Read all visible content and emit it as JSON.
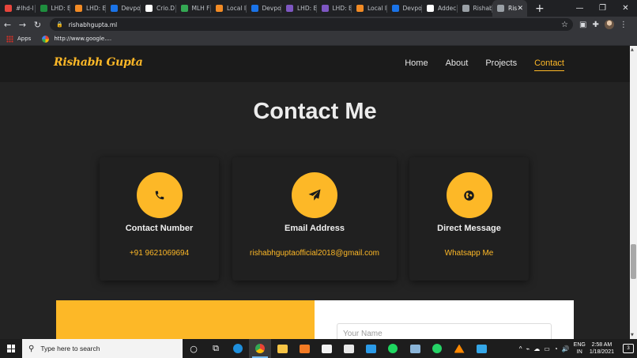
{
  "browser": {
    "tabs": [
      {
        "label": "#lhd-l",
        "color": "#e8453c"
      },
      {
        "label": "LHD: B",
        "color": "#1e8e3e"
      },
      {
        "label": "LHD: B",
        "color": "#f28b25"
      },
      {
        "label": "Devpo",
        "color": "#1a73e8"
      },
      {
        "label": "Crio.D",
        "color": "#ffffff"
      },
      {
        "label": "MLH F",
        "color": "#34a853"
      },
      {
        "label": "Local I",
        "color": "#f28b25"
      },
      {
        "label": "Devpo",
        "color": "#1a73e8"
      },
      {
        "label": "LHD: B",
        "color": "#7e57c2"
      },
      {
        "label": "LHD: B",
        "color": "#7e57c2"
      },
      {
        "label": "Local I",
        "color": "#f28b25"
      },
      {
        "label": "Devpo",
        "color": "#1a73e8"
      },
      {
        "label": "Addec",
        "color": "#ffffff"
      },
      {
        "label": "Rishab",
        "color": "#9aa0a6"
      },
      {
        "label": "Ris",
        "color": "#9aa0a6",
        "active": true
      }
    ],
    "new_tab": "+",
    "window_controls": {
      "minimize": "—",
      "maximize": "❐",
      "close": "✕"
    },
    "url": "rishabhgupta.ml",
    "bookmarks": [
      {
        "label": "Apps",
        "icon": "apps-grid-icon"
      },
      {
        "label": "http://www.google....",
        "icon": "google-icon"
      }
    ]
  },
  "site": {
    "logo": "Rishabh Gupta",
    "nav": [
      {
        "label": "Home",
        "active": false
      },
      {
        "label": "About",
        "active": false
      },
      {
        "label": "Projects",
        "active": false
      },
      {
        "label": "Contact",
        "active": true
      }
    ],
    "section_title": "Contact Me",
    "cards": [
      {
        "title": "Contact Number",
        "value": "+91 9621069694",
        "icon": "phone-icon"
      },
      {
        "title": "Email Address",
        "value": "rishabhguptaofficial2018@gmail.com",
        "icon": "paper-plane-icon"
      },
      {
        "title": "Direct Message",
        "value": "Whatsapp Me",
        "icon": "globe-icon"
      }
    ],
    "form": {
      "name_placeholder": "Your Name"
    },
    "accent": "#fdb827"
  },
  "taskbar": {
    "search_placeholder": "Type here to search",
    "lang_line1": "ENG",
    "lang_line2": "IN",
    "time": "2:58 AM",
    "date": "1/18/2021",
    "notification_count": "3"
  }
}
